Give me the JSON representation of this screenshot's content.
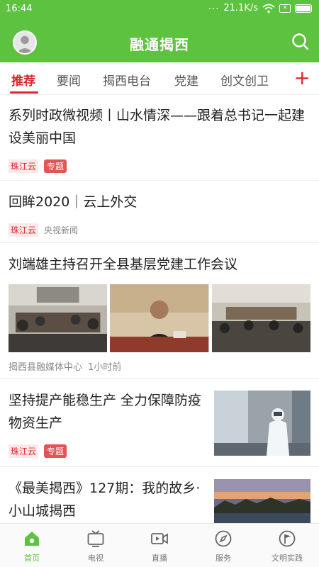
{
  "status_bar": {
    "time": "16:44",
    "dots": "...",
    "speed": "21.1K/s"
  },
  "header": {
    "title": "融通揭西"
  },
  "tabs": [
    {
      "label": "推荐",
      "active": true
    },
    {
      "label": "要闻"
    },
    {
      "label": "揭西电台"
    },
    {
      "label": "党建"
    },
    {
      "label": "创文创卫"
    }
  ],
  "add_tab": "+",
  "feed": [
    {
      "title": "系列时政微视频丨山水情深——跟着总书记一起建设美丽中国",
      "source": "珠江云",
      "tag": "专题"
    },
    {
      "title": "回眸2020｜云上外交",
      "source": "珠江云",
      "publisher": "央视新闻"
    },
    {
      "title": "刘端雄主持召开全县基层党建工作会议",
      "publisher": "揭西县融媒体中心",
      "time": "1小时前"
    },
    {
      "title": "坚持提产能稳生产 全力保障防疫物资生产",
      "source": "珠江云",
      "tag": "专题"
    },
    {
      "title": "《最美揭西》127期：我的故乡·小山城揭西"
    }
  ],
  "bottom_nav": [
    {
      "label": "首页",
      "icon": "home-icon",
      "active": true
    },
    {
      "label": "电视",
      "icon": "tv-icon"
    },
    {
      "label": "直播",
      "icon": "live-video-icon"
    },
    {
      "label": "服务",
      "icon": "compass-icon"
    },
    {
      "label": "文明实践",
      "icon": "flag-icon"
    }
  ],
  "colors": {
    "brand_green": "#5cc23f",
    "accent_red": "#d9272d"
  }
}
